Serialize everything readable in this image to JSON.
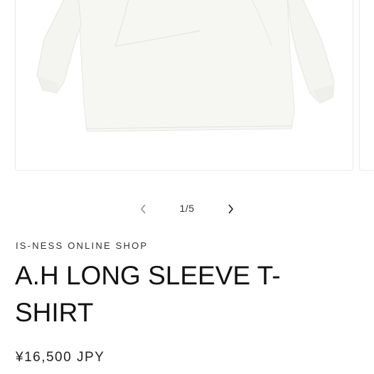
{
  "gallery": {
    "image_alt": "A.H Long Sleeve T-Shirt white",
    "prev_icon": "chevron-left-icon",
    "next_icon": "chevron-right-icon",
    "counter": "1/5"
  },
  "product": {
    "vendor": "IS-NESS ONLINE SHOP",
    "title": "A.H LONG SLEEVE T-SHIRT",
    "price": "¥16,500 JPY"
  },
  "colors": {
    "shirt": "#f6f6f3",
    "card_border": "#e9e9e9",
    "text": "#121212"
  }
}
